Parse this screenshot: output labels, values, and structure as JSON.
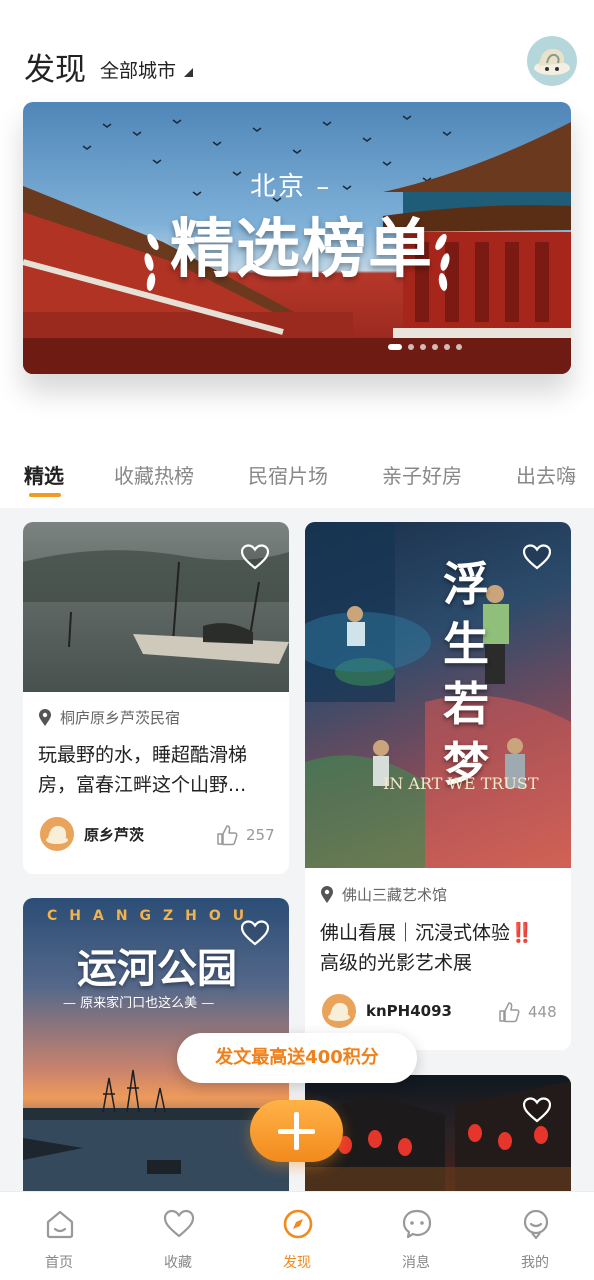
{
  "header": {
    "title": "发现",
    "city_selector": "全部城市"
  },
  "banner": {
    "city": "北京 –",
    "title": "精选榜单"
  },
  "tabs": [
    {
      "label": "精选",
      "active": true
    },
    {
      "label": "收藏热榜",
      "active": false
    },
    {
      "label": "民宿片场",
      "active": false
    },
    {
      "label": "亲子好房",
      "active": false
    },
    {
      "label": "出去嗨",
      "active": false
    }
  ],
  "cards": [
    {
      "location": "桐庐原乡芦茨民宿",
      "text_line1": "玩最野的水，睡超酷滑梯",
      "text_line2": "房，富春江畔这个山野...",
      "author": "原乡芦茨",
      "likes": "257"
    },
    {
      "image_title": "浮生若梦",
      "image_subtitle": "IN ART WE TRUST",
      "location": "佛山三藏艺术馆",
      "text_line1": "佛山看展｜沉浸式体验‼️",
      "text_line2": "高级的光影艺术展",
      "author": "knPH4093",
      "likes": "448"
    },
    {
      "image_kicker": "CHANGZHOU",
      "image_title": "运河公园",
      "image_subtitle": "— 原来家门口也这么美 —"
    },
    {}
  ],
  "promo": {
    "label": "发文最高送400积分"
  },
  "bottom_nav": [
    {
      "label": "首页",
      "icon": "home-icon",
      "active": false
    },
    {
      "label": "收藏",
      "icon": "heart-icon",
      "active": false
    },
    {
      "label": "发现",
      "icon": "compass-icon",
      "active": true
    },
    {
      "label": "消息",
      "icon": "message-icon",
      "active": false
    },
    {
      "label": "我的",
      "icon": "profile-icon",
      "active": false
    }
  ],
  "colors": {
    "accent": "#f28a1d",
    "promo_text": "#f0801a"
  }
}
